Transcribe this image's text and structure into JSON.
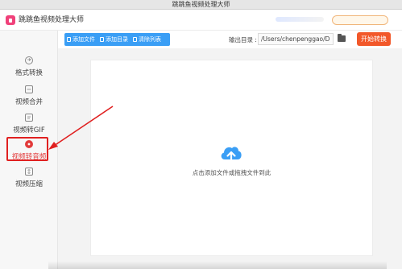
{
  "window": {
    "title": "跳跳鱼视频处理大师"
  },
  "app": {
    "name": "跳跳鱼视频处理大师"
  },
  "sidebar": {
    "items": [
      {
        "label": "格式转换",
        "icon": "format-convert-icon"
      },
      {
        "label": "视频合并",
        "icon": "video-merge-icon"
      },
      {
        "label": "视频转GIF",
        "icon": "gif-icon"
      },
      {
        "label": "视频转音频",
        "icon": "audio-icon",
        "active": true
      },
      {
        "label": "视频压缩",
        "icon": "compress-icon"
      }
    ]
  },
  "toolbar": {
    "add_file": "添加文件",
    "add_folder": "添加目录",
    "clear_list": "清除列表"
  },
  "output": {
    "label": "输出目录 :",
    "path": "/Users/chenpenggao/D"
  },
  "start_button": "开始转换",
  "dropzone": {
    "hint": "点击添加文件或拖拽文件到此"
  },
  "colors": {
    "toolbar": "#3a9ef5",
    "start_button": "#f2582a",
    "highlight": "#e02020",
    "upload_icon": "#3a9ef5"
  }
}
